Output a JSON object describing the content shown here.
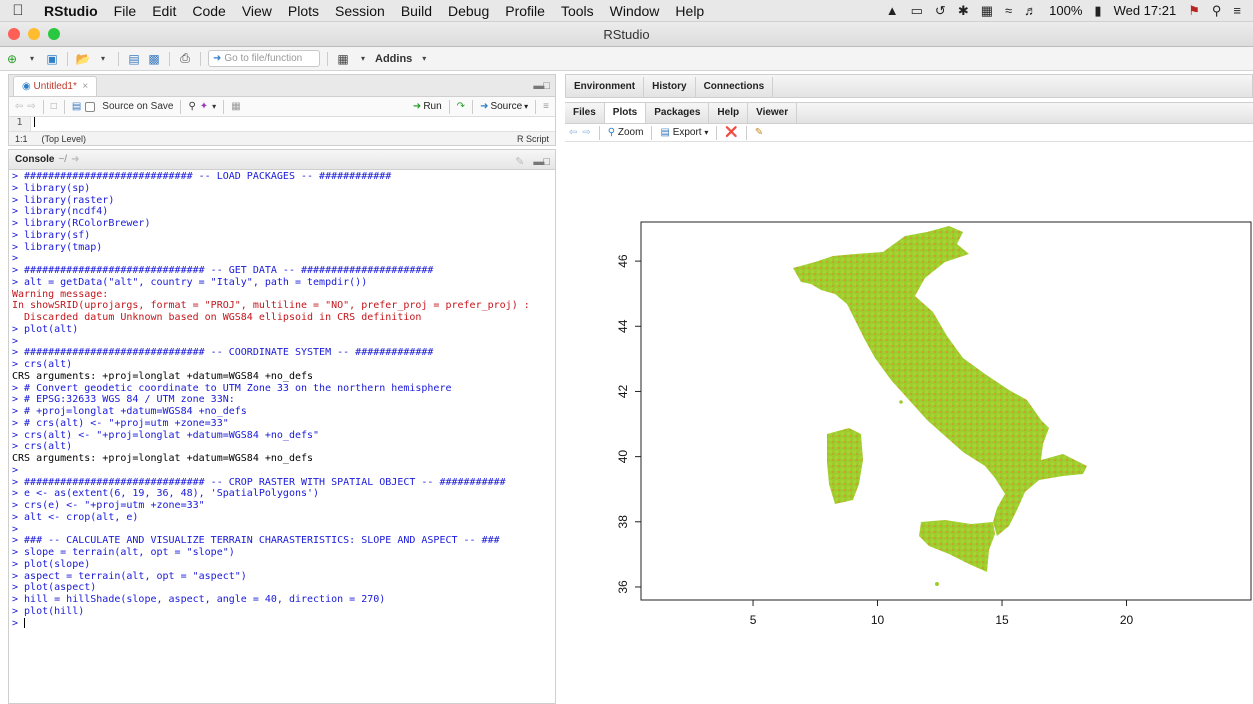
{
  "menubar": {
    "app": "RStudio",
    "items": [
      "File",
      "Edit",
      "Code",
      "View",
      "Plots",
      "Session",
      "Build",
      "Debug",
      "Profile",
      "Tools",
      "Window",
      "Help"
    ],
    "battery": "100%",
    "clock": "Wed 17:21"
  },
  "window": {
    "title": "RStudio"
  },
  "toolbar": {
    "goto_placeholder": "Go to file/function",
    "addins_label": "Addins"
  },
  "source": {
    "tab_label": "Untitled1*",
    "source_on_save": "Source on Save",
    "run_label": "Run",
    "source_label": "Source",
    "line_number": "1",
    "position": "1:1",
    "scope": "(Top Level)",
    "file_type": "R Script"
  },
  "console": {
    "title": "Console",
    "path": "~/",
    "lines": [
      {
        "t": "cmd",
        "s": "> ############################ -- LOAD PACKAGES -- ############"
      },
      {
        "t": "cmd",
        "s": "> library(sp)"
      },
      {
        "t": "cmd",
        "s": "> library(raster)"
      },
      {
        "t": "cmd",
        "s": "> library(ncdf4)"
      },
      {
        "t": "cmd",
        "s": "> library(RColorBrewer)"
      },
      {
        "t": "cmd",
        "s": "> library(sf)"
      },
      {
        "t": "cmd",
        "s": "> library(tmap)"
      },
      {
        "t": "cmd",
        "s": ">"
      },
      {
        "t": "cmd",
        "s": "> ############################## -- GET DATA -- ######################"
      },
      {
        "t": "cmd",
        "s": "> alt = getData(\"alt\", country = \"Italy\", path = tempdir())"
      },
      {
        "t": "warn",
        "s": "Warning message:"
      },
      {
        "t": "warn",
        "s": "In showSRID(uprojargs, format = \"PROJ\", multiline = \"NO\", prefer_proj = prefer_proj) :"
      },
      {
        "t": "warn",
        "s": "  Discarded datum Unknown based on WGS84 ellipsoid in CRS definition"
      },
      {
        "t": "cmd",
        "s": "> plot(alt)"
      },
      {
        "t": "cmd",
        "s": ">"
      },
      {
        "t": "cmd",
        "s": "> ############################## -- COORDINATE SYSTEM -- #############"
      },
      {
        "t": "cmd",
        "s": "> crs(alt)"
      },
      {
        "t": "out",
        "s": "CRS arguments: +proj=longlat +datum=WGS84 +no_defs"
      },
      {
        "t": "cmd",
        "s": "> # Convert geodetic coordinate to UTM Zone 33 on the northern hemisphere"
      },
      {
        "t": "cmd",
        "s": "> # EPSG:32633 WGS 84 / UTM zone 33N:"
      },
      {
        "t": "cmd",
        "s": "> # +proj=longlat +datum=WGS84 +no_defs"
      },
      {
        "t": "cmd",
        "s": "> # crs(alt) <- \"+proj=utm +zone=33\""
      },
      {
        "t": "cmd",
        "s": "> crs(alt) <- \"+proj=longlat +datum=WGS84 +no_defs\""
      },
      {
        "t": "cmd",
        "s": "> crs(alt)"
      },
      {
        "t": "out",
        "s": "CRS arguments: +proj=longlat +datum=WGS84 +no_defs"
      },
      {
        "t": "cmd",
        "s": ">"
      },
      {
        "t": "cmd",
        "s": "> ############################## -- CROP RASTER WITH SPATIAL OBJECT -- ###########"
      },
      {
        "t": "cmd",
        "s": "> e <- as(extent(6, 19, 36, 48), 'SpatialPolygons')"
      },
      {
        "t": "cmd",
        "s": "> crs(e) <- \"+proj=utm +zone=33\""
      },
      {
        "t": "cmd",
        "s": "> alt <- crop(alt, e)"
      },
      {
        "t": "cmd",
        "s": ">"
      },
      {
        "t": "cmd",
        "s": "> ### -- CALCULATE AND VISUALIZE TERRAIN CHARASTERISTICS: SLOPE AND ASPECT -- ###"
      },
      {
        "t": "cmd",
        "s": "> slope = terrain(alt, opt = \"slope\")"
      },
      {
        "t": "cmd",
        "s": "> plot(slope)"
      },
      {
        "t": "cmd",
        "s": "> aspect = terrain(alt, opt = \"aspect\")"
      },
      {
        "t": "cmd",
        "s": "> plot(aspect)"
      },
      {
        "t": "cmd",
        "s": "> hill = hillShade(slope, aspect, angle = 40, direction = 270)"
      },
      {
        "t": "cmd",
        "s": "> plot(hill)"
      }
    ],
    "prompt": ">"
  },
  "env_tabs": [
    "Environment",
    "History",
    "Connections"
  ],
  "files_tabs": [
    "Files",
    "Plots",
    "Packages",
    "Help",
    "Viewer"
  ],
  "plot_toolbar": {
    "zoom": "Zoom",
    "export": "Export"
  },
  "chart_data": {
    "type": "raster-map",
    "x_ticks": [
      "5",
      "10",
      "15",
      "20"
    ],
    "y_ticks": [
      "36",
      "38",
      "40",
      "42",
      "44",
      "46"
    ],
    "xlim": [
      0.5,
      25
    ],
    "ylim": [
      35.6,
      47.2
    ],
    "fill_color": "#9ccd2c"
  }
}
